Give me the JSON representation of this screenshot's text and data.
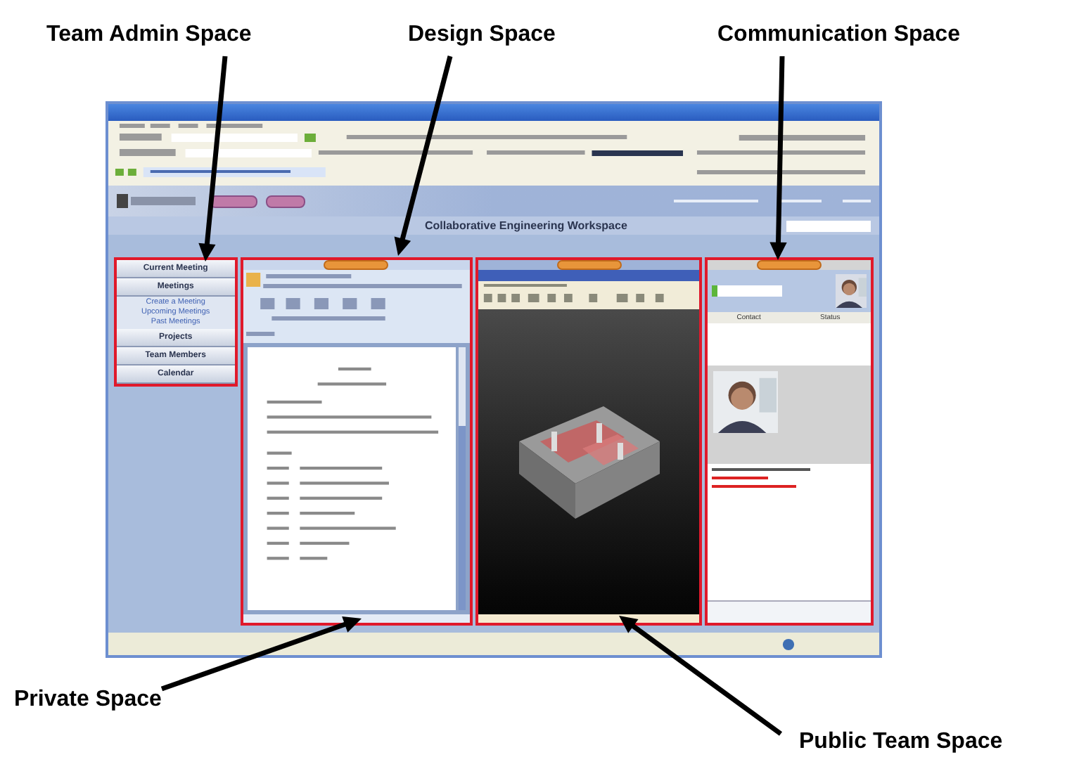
{
  "callouts": {
    "top": [
      "Team Admin Space",
      "Design Space",
      "Communication Space"
    ],
    "bottom": [
      "Private Space",
      "Public Team Space"
    ]
  },
  "app": {
    "workspace_title": "Collaborative Engineering Workspace",
    "sidebar": {
      "items": [
        {
          "label": "Current Meeting"
        },
        {
          "label": "Meetings",
          "children": [
            {
              "label": "Create a Meeting"
            },
            {
              "label": "Upcoming Meetings"
            },
            {
              "label": "Past Meetings"
            }
          ]
        },
        {
          "label": "Projects"
        },
        {
          "label": "Team Members"
        },
        {
          "label": "Calendar"
        }
      ]
    },
    "contacts": {
      "columns": [
        "Contact",
        "Status"
      ]
    }
  }
}
